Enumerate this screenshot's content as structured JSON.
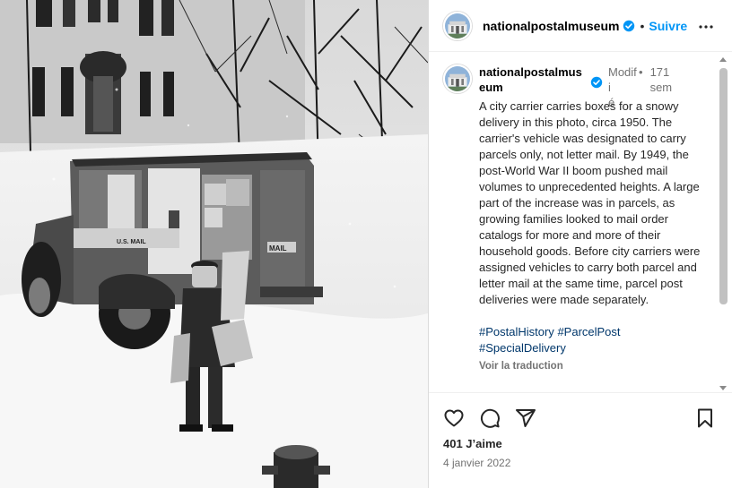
{
  "post": {
    "photo_alt": "City carrier carrying boxes beside a mail truck in snow",
    "truck_markings": [
      "U.S. MAIL",
      "MAIL"
    ]
  },
  "header": {
    "username": "nationalpostalmuseum",
    "separator": "•",
    "follow_label": "Suivre"
  },
  "comment": {
    "username": "nationalpostalmuseum",
    "username_line1": "nationalpostalmus",
    "username_line2": "eum",
    "edited_line1": "Modifi",
    "edited_line2": "é",
    "separator": "•",
    "age_line1": "171",
    "age_line2": "sem",
    "caption": "A city carrier carries boxes for a snowy delivery in this photo, circa 1950. The carrier's vehicle was designated to carry parcels only, not letter mail. By 1949, the post-World War II boom pushed mail volumes to unprecedented heights. A large part of the increase was in parcels, as growing families looked to mail order catalogs for more and more of their household goods. Before city carriers were assigned vehicles to carry both parcel and letter mail at the same time, parcel post deliveries were made separately.",
    "hashtags": [
      "#PostalHistory",
      "#ParcelPost",
      "#SpecialDelivery"
    ],
    "translate_label": "Voir la traduction"
  },
  "actions": {
    "likes": "401 J’aime",
    "date": "4 janvier 2022"
  },
  "colors": {
    "accent": "#0095f6",
    "hashtag": "#00376b",
    "muted": "#737373",
    "verified": "#0095f6"
  },
  "icons": [
    "more-icon",
    "verified-icon",
    "heart-icon",
    "comment-icon",
    "share-icon",
    "bookmark-icon"
  ]
}
